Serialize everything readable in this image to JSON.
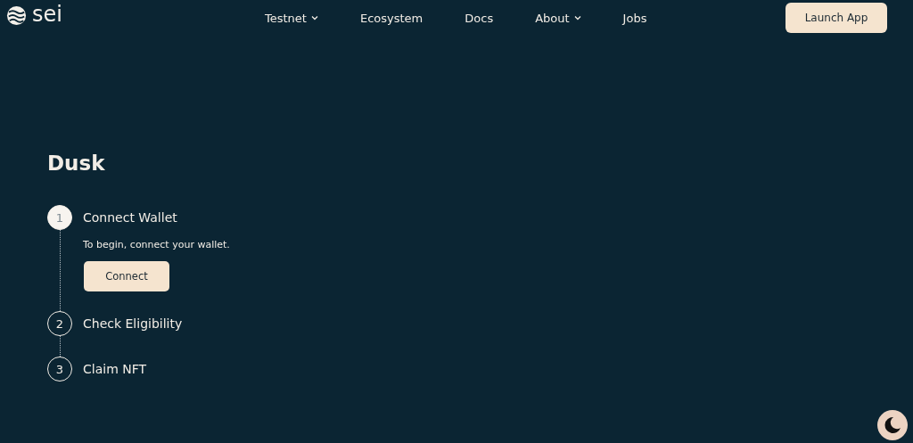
{
  "logo": {
    "text": "sei"
  },
  "nav": [
    {
      "label": "Testnet",
      "dropdown": true
    },
    {
      "label": "Ecosystem",
      "dropdown": false
    },
    {
      "label": "Docs",
      "dropdown": false
    },
    {
      "label": "About",
      "dropdown": true
    },
    {
      "label": "Jobs",
      "dropdown": false
    }
  ],
  "launch_button": "Launch App",
  "title": "Dusk",
  "steps": [
    {
      "number": "1",
      "label": "Connect Wallet",
      "active": true,
      "description": "To begin, connect your wallet.",
      "button": "Connect"
    },
    {
      "number": "2",
      "label": "Check Eligibility",
      "active": false
    },
    {
      "number": "3",
      "label": "Claim NFT",
      "active": false
    }
  ]
}
